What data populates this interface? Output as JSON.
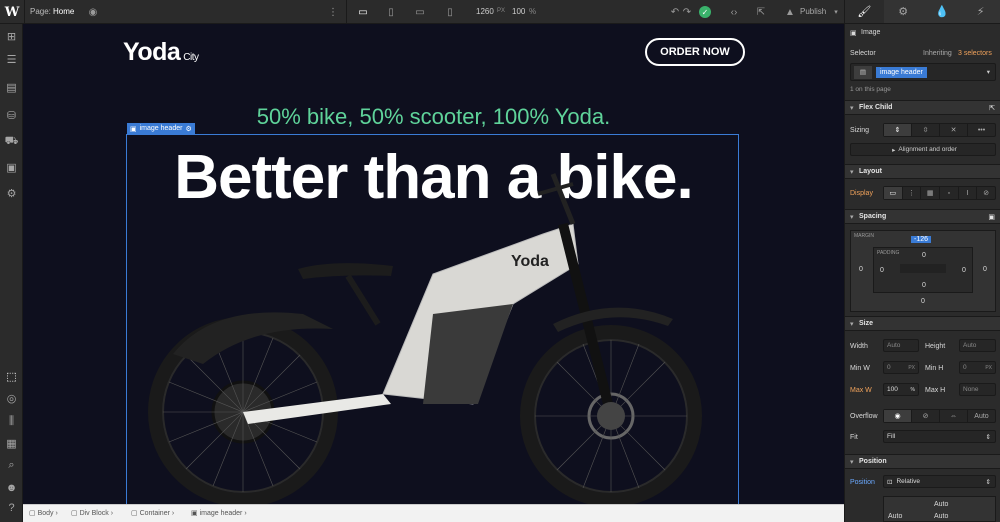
{
  "topbar": {
    "page_label": "Page:",
    "page_name": "Home",
    "width_value": "1260",
    "width_unit": "PX",
    "zoom_value": "100",
    "zoom_unit": "%",
    "publish_label": "Publish"
  },
  "canvas": {
    "brand_name": "Yoda",
    "brand_sub": "City",
    "order_button": "ORDER NOW",
    "tagline": "50% bike, 50% scooter, 100% Yoda.",
    "hero_title": "Better than a bike.",
    "selected_tag": "image header",
    "bike_brand": "Yoda"
  },
  "breadcrumb": {
    "items": [
      "Body",
      "Div Block",
      "Container",
      "image header"
    ]
  },
  "rpanel": {
    "element_type": "Image",
    "selector_label": "Selector",
    "inheriting_prefix": "Inheriting",
    "inheriting_count": "3 selectors",
    "selector_chip": "image header",
    "on_page": "1 on this page",
    "flex_child": "Flex Child",
    "sizing_label": "Sizing",
    "alignment_label": "Alignment and order",
    "layout": "Layout",
    "display_label": "Display",
    "spacing": "Spacing",
    "margin_label": "MARGIN",
    "margin_top": "-126",
    "padding_label": "PADDING",
    "zero": "0",
    "size": "Size",
    "width_label": "Width",
    "height_label": "Height",
    "auto": "Auto",
    "minw_label": "Min W",
    "minh_label": "Min H",
    "px": "PX",
    "maxw_label": "Max W",
    "maxw_value": "100",
    "pct": "%",
    "maxh_label": "Max H",
    "none": "None",
    "overflow_label": "Overflow",
    "fit_label": "Fit",
    "fit_value": "Fill",
    "position": "Position",
    "position_label": "Position",
    "position_value": "Relative"
  },
  "colors": {
    "accent": "#3a7bd5",
    "tagline": "#5fd39a",
    "warn": "#f0a25b",
    "canvas_bg": "#0e0f1e"
  }
}
